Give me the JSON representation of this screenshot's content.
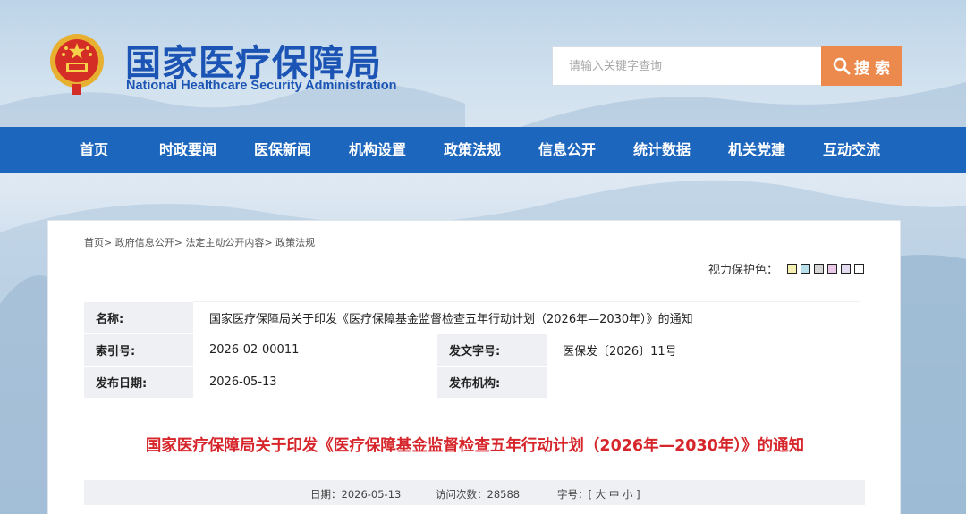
{
  "header": {
    "title": "国家医疗保障局",
    "subtitle": "National Healthcare Security Administration",
    "search": {
      "placeholder": "请输入关键字查询",
      "button_label": "搜 索"
    }
  },
  "nav": {
    "items": [
      "首页",
      "时政要闻",
      "医保新闻",
      "机构设置",
      "政策法规",
      "信息公开",
      "统计数据",
      "机关党建",
      "互动交流"
    ]
  },
  "breadcrumb": [
    "首页",
    "政府信息公开",
    "法定主动公开内容",
    "政策法规"
  ],
  "eye_protection": {
    "label": "视力保护色：",
    "swatches": [
      "#f6f0b4",
      "#b6e1ec",
      "#d6d6d6",
      "#e9c9e6",
      "#e5dbf0",
      "#ffffff"
    ]
  },
  "meta": {
    "name_label": "名称:",
    "name_value": "国家医疗保障局关于印发《医疗保障基金监督检查五年行动计划（2026年—2030年）》的通知",
    "index_label": "索引号:",
    "index_value": "2026-02-00011",
    "doc_no_label": "发文字号:",
    "doc_no_value": "医保发〔2026〕11号",
    "date_label": "发布日期:",
    "date_value": "2026-05-13",
    "org_label": "发布机构:",
    "org_value": ""
  },
  "article": {
    "title": "国家医疗保障局关于印发《医疗保障基金监督检查五年行动计划（2026年—2030年）》的通知",
    "date_label": "日期：",
    "date": "2026-05-13",
    "visits_label": "访问次数：",
    "visits": "28588",
    "font_label": "字号：[",
    "font_large": "大",
    "font_medium": "中",
    "font_small": "小",
    "font_close": "]"
  },
  "colors": {
    "brand_blue": "#1b54b4",
    "nav_blue": "#1d66bd",
    "search_orange": "#ec8a4d",
    "title_red": "#d6262b"
  }
}
